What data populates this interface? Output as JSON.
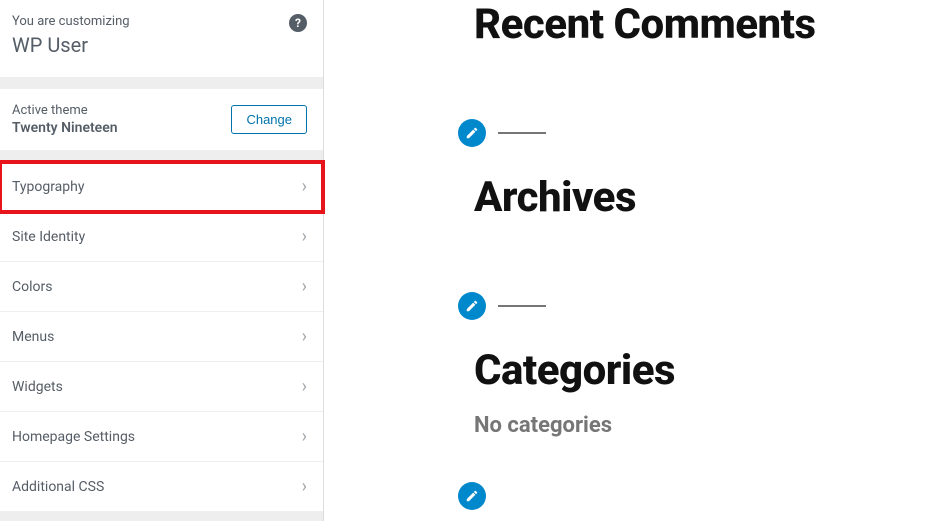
{
  "header": {
    "customizing_label": "You are customizing",
    "site_title": "WP User",
    "help_glyph": "?"
  },
  "theme": {
    "active_label": "Active theme",
    "name": "Twenty Nineteen",
    "change_label": "Change"
  },
  "menu": {
    "items": [
      {
        "label": "Typography",
        "highlighted": true
      },
      {
        "label": "Site Identity",
        "highlighted": false
      },
      {
        "label": "Colors",
        "highlighted": false
      },
      {
        "label": "Menus",
        "highlighted": false
      },
      {
        "label": "Widgets",
        "highlighted": false
      },
      {
        "label": "Homepage Settings",
        "highlighted": false
      },
      {
        "label": "Additional CSS",
        "highlighted": false
      }
    ]
  },
  "preview": {
    "recent_comments_title": "Recent Comments",
    "archives_title": "Archives",
    "categories_title": "Categories",
    "no_categories_text": "No categories"
  }
}
